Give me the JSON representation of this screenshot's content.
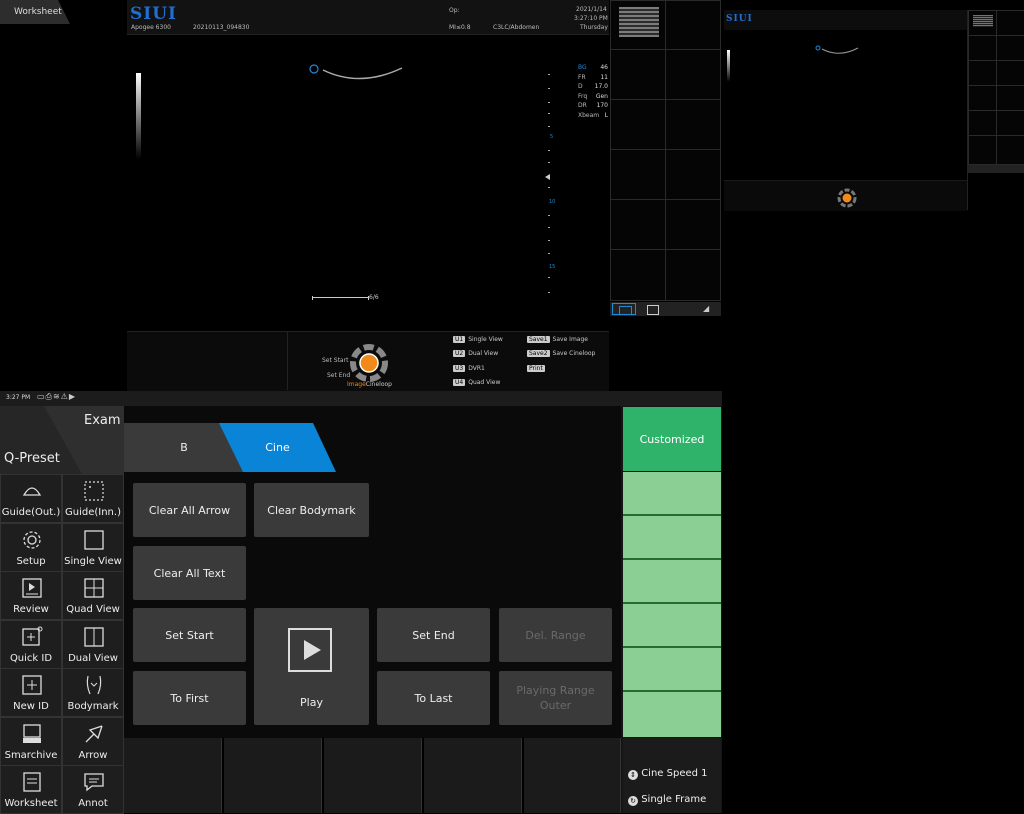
{
  "worksheet_tab": "Worksheet",
  "header": {
    "logo": "SIUI",
    "model": "Apogee 6300",
    "patient_id": "20210113_094830",
    "operator": "Op:",
    "mi": "MI≤0.8",
    "probe_preset": "C3LC/Abdomen",
    "date": "2021/1/14",
    "time": "3:27:10 PM",
    "weekday": "Thursday"
  },
  "params": [
    {
      "k": "BG",
      "v": "46"
    },
    {
      "k": "FR",
      "v": "11"
    },
    {
      "k": "D",
      "v": "17.0"
    },
    {
      "k": "Frq",
      "v": "Gen"
    },
    {
      "k": "DR",
      "v": "170"
    },
    {
      "k": "Xbeam",
      "v": "L"
    }
  ],
  "depth_marks": [
    "5",
    "10",
    "15"
  ],
  "cine_counter": "6/6",
  "wheel": {
    "set_start": "Set Start",
    "set_end": "Set End",
    "image_label": "Image",
    "cineloop_label": "Cineloop"
  },
  "shortcuts": [
    {
      "key": "U1",
      "label": "Single View"
    },
    {
      "key": "U2",
      "label": "Dual View"
    },
    {
      "key": "U3",
      "label": "DVR1"
    },
    {
      "key": "U4",
      "label": "Quad View"
    },
    {
      "key": "Save1",
      "label": "Save Image"
    },
    {
      "key": "Save2",
      "label": "Save Cineloop"
    },
    {
      "key": "Print",
      "label": ""
    }
  ],
  "status_time": "3:27 PM",
  "left_panel": {
    "exam": "Exam",
    "qpreset": "Q-Preset",
    "buttons": [
      {
        "label": "Guide(Out.)",
        "icon": "probe-out-icon"
      },
      {
        "label": "Guide(Inn.)",
        "icon": "probe-in-icon"
      },
      {
        "label": "Setup",
        "icon": "gear-icon"
      },
      {
        "label": "Single View",
        "icon": "single-view-icon"
      },
      {
        "label": "Review",
        "icon": "review-icon"
      },
      {
        "label": "Quad View",
        "icon": "quad-view-icon"
      },
      {
        "label": "Quick ID",
        "icon": "quick-id-icon"
      },
      {
        "label": "Dual View",
        "icon": "dual-view-icon"
      },
      {
        "label": "New ID",
        "icon": "new-id-icon"
      },
      {
        "label": "Bodymark",
        "icon": "bodymark-icon"
      },
      {
        "label": "Smarchive",
        "icon": "smarchive-icon"
      },
      {
        "label": "Arrow",
        "icon": "arrow-icon"
      },
      {
        "label": "Worksheet",
        "icon": "worksheet-icon"
      },
      {
        "label": "Annot",
        "icon": "annot-icon"
      }
    ]
  },
  "tabs": {
    "b": "B",
    "cine": "Cine"
  },
  "controls": {
    "clear_all_arrow": "Clear All Arrow",
    "clear_bodymark": "Clear Bodymark",
    "clear_all_text": "Clear All Text",
    "set_start": "Set Start",
    "play": "Play",
    "set_end": "Set End",
    "del_range": "Del. Range",
    "to_first": "To First",
    "to_last": "To Last",
    "playing_range_outer": "Playing Range Outer"
  },
  "right_panel": {
    "customized": "Customized",
    "cine_speed": "Cine Speed 1",
    "single_frame": "Single Frame"
  },
  "colors": {
    "accent": "#0a84d6",
    "green": "#2fb36b",
    "green_light": "#8ccf95",
    "logo": "#1f6fd0"
  }
}
